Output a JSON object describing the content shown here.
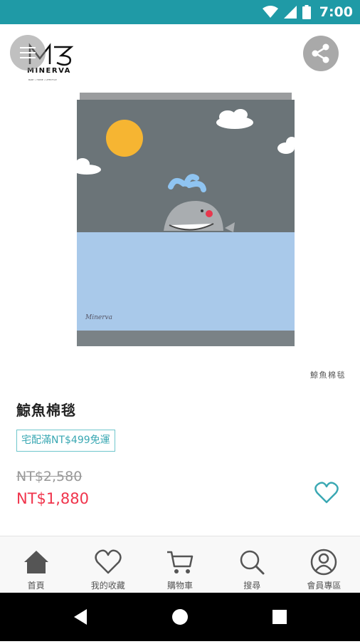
{
  "status_bar": {
    "time": "7:00"
  },
  "header": {
    "logo_text": "MINERVA",
    "logo_subtext": "BABY • HOME • LIFESTYLE"
  },
  "product": {
    "image_caption": "鯨魚棉毯",
    "title": "鯨魚棉毯",
    "shipping_badge": "宅配滿NT$499免運",
    "original_price": "NT$2,580",
    "sale_price": "NT$1,880",
    "image_watermark": "Minerva"
  },
  "colors": {
    "accent": "#1f9aa6",
    "sale_price": "#f0344c",
    "badge": "#3aa8b3"
  },
  "bottom_nav": [
    {
      "label": "首頁",
      "icon": "home-icon"
    },
    {
      "label": "我的收藏",
      "icon": "heart-icon"
    },
    {
      "label": "購物車",
      "icon": "cart-icon"
    },
    {
      "label": "搜尋",
      "icon": "search-icon"
    },
    {
      "label": "會員專區",
      "icon": "user-icon"
    }
  ]
}
